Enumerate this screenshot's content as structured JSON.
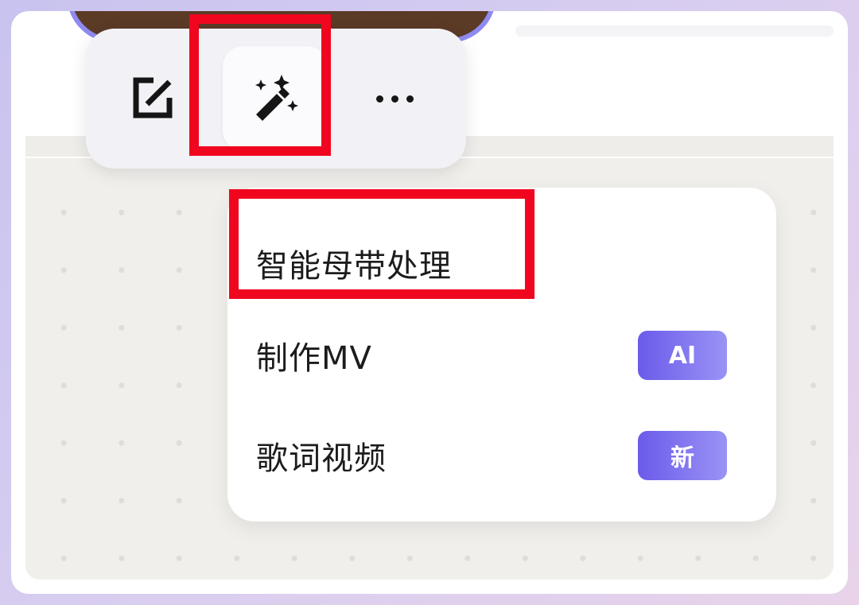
{
  "toolbar": {
    "buttons": [
      {
        "name": "edit",
        "icon": "edit-icon"
      },
      {
        "name": "magic",
        "icon": "magic-wand-icon"
      },
      {
        "name": "more",
        "icon": "more-icon"
      }
    ]
  },
  "menu": {
    "items": [
      {
        "label": "智能母带处理",
        "badge": ""
      },
      {
        "label": "制作MV",
        "badge": "AI"
      },
      {
        "label": "歌词视频",
        "badge": "新"
      }
    ]
  },
  "colors": {
    "highlight": "#f0061e",
    "badge_start": "#6a5bea",
    "badge_end": "#9a93f5",
    "canvas": "#f1efeb"
  }
}
